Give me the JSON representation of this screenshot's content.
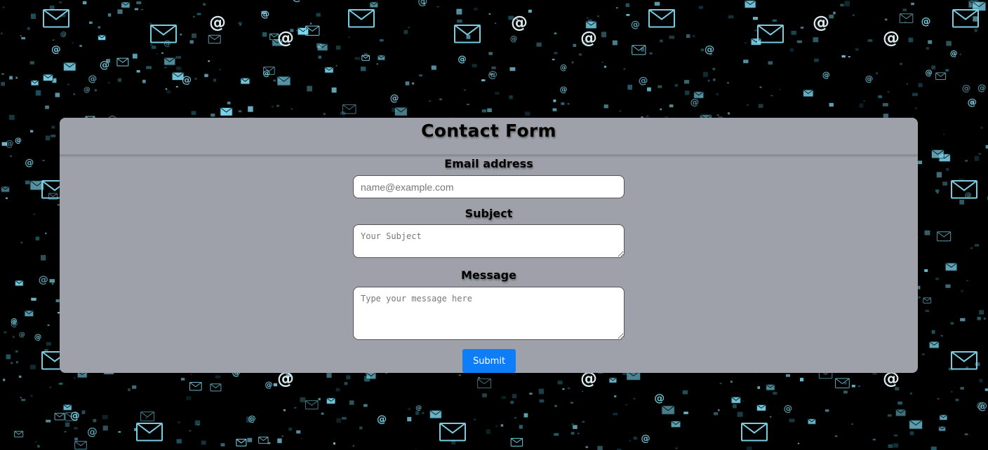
{
  "form": {
    "title": "Contact Form",
    "email_label": "Email address",
    "email_placeholder": "name@example.com",
    "subject_label": "Subject",
    "subject_placeholder": "Your Subject",
    "message_label": "Message",
    "message_placeholder": "Type your message here",
    "submit_label": "Submit"
  },
  "colors": {
    "background": "#000000",
    "card": "#9ea1a9",
    "accent": "#0d7ef8",
    "icon_glow": "#7fd8ee"
  },
  "background_pattern": {
    "icons": [
      "envelope-icon",
      "at-sign-icon"
    ]
  }
}
